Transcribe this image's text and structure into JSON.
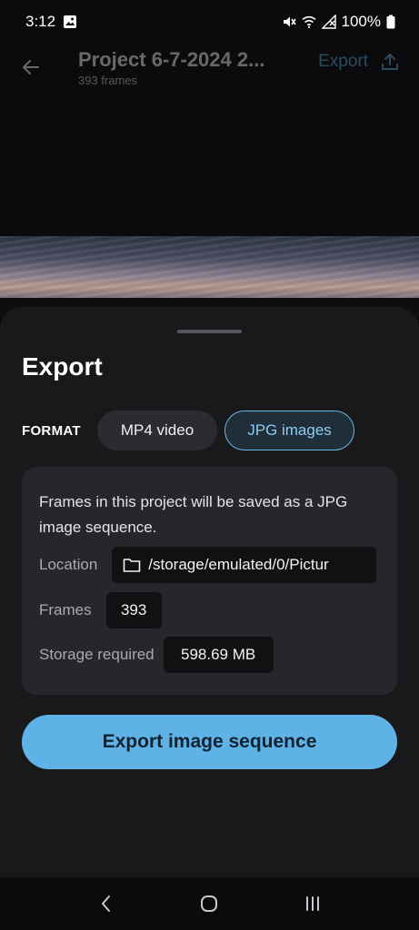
{
  "status_bar": {
    "time": "3:12",
    "battery": "100%",
    "icons": [
      "image-icon",
      "mute-icon",
      "wifi-icon",
      "no-signal-icon",
      "battery-icon"
    ]
  },
  "app_bar": {
    "title": "Project 6-7-2024 2...",
    "subtitle": "393 frames",
    "export_label": "Export",
    "icons": [
      "back-arrow-icon",
      "upload-icon"
    ]
  },
  "sheet": {
    "title": "Export",
    "format_label": "FORMAT",
    "options": [
      "MP4 video",
      "JPG images"
    ],
    "selected_option": "JPG images",
    "description": "Frames in this project will be saved as a JPG image sequence.",
    "location_label": "Location",
    "location_value": "/storage/emulated/0/Pictur",
    "frames_label": "Frames",
    "frames_value": "393",
    "storage_label": "Storage required",
    "storage_value": "598.69 MB",
    "cta_label": "Export image sequence"
  },
  "nav_bar": {
    "icons": [
      "nav-back-icon",
      "home-icon",
      "recents-icon"
    ]
  },
  "colors": {
    "accent": "#5fb2e6",
    "sheet_bg": "#19191c",
    "card_bg": "#26262b"
  }
}
